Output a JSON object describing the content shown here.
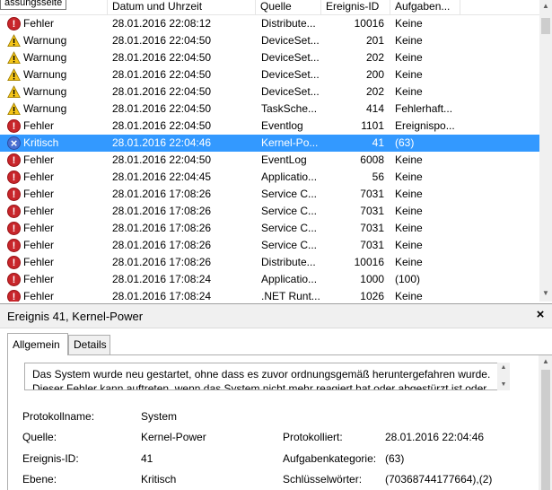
{
  "tooltip": "assungsseite",
  "list": {
    "columns": [
      "",
      "Datum und Uhrzeit",
      "Quelle",
      "Ereignis-ID",
      "Aufgaben..."
    ],
    "rows": [
      {
        "icon": "error",
        "level": "Fehler",
        "date": "28.01.2016 22:08:12",
        "source": "Distribute...",
        "id": "10016",
        "task": "Keine"
      },
      {
        "icon": "warning",
        "level": "Warnung",
        "date": "28.01.2016 22:04:50",
        "source": "DeviceSet...",
        "id": "201",
        "task": "Keine"
      },
      {
        "icon": "warning",
        "level": "Warnung",
        "date": "28.01.2016 22:04:50",
        "source": "DeviceSet...",
        "id": "202",
        "task": "Keine"
      },
      {
        "icon": "warning",
        "level": "Warnung",
        "date": "28.01.2016 22:04:50",
        "source": "DeviceSet...",
        "id": "200",
        "task": "Keine"
      },
      {
        "icon": "warning",
        "level": "Warnung",
        "date": "28.01.2016 22:04:50",
        "source": "DeviceSet...",
        "id": "202",
        "task": "Keine"
      },
      {
        "icon": "warning",
        "level": "Warnung",
        "date": "28.01.2016 22:04:50",
        "source": "TaskSche...",
        "id": "414",
        "task": "Fehlerhaft..."
      },
      {
        "icon": "error",
        "level": "Fehler",
        "date": "28.01.2016 22:04:50",
        "source": "Eventlog",
        "id": "1101",
        "task": "Ereignispo..."
      },
      {
        "icon": "critical",
        "level": "Kritisch",
        "date": "28.01.2016 22:04:46",
        "source": "Kernel-Po...",
        "id": "41",
        "task": "(63)",
        "selected": true
      },
      {
        "icon": "error",
        "level": "Fehler",
        "date": "28.01.2016 22:04:50",
        "source": "EventLog",
        "id": "6008",
        "task": "Keine"
      },
      {
        "icon": "error",
        "level": "Fehler",
        "date": "28.01.2016 22:04:45",
        "source": "Applicatio...",
        "id": "56",
        "task": "Keine"
      },
      {
        "icon": "error",
        "level": "Fehler",
        "date": "28.01.2016 17:08:26",
        "source": "Service C...",
        "id": "7031",
        "task": "Keine"
      },
      {
        "icon": "error",
        "level": "Fehler",
        "date": "28.01.2016 17:08:26",
        "source": "Service C...",
        "id": "7031",
        "task": "Keine"
      },
      {
        "icon": "error",
        "level": "Fehler",
        "date": "28.01.2016 17:08:26",
        "source": "Service C...",
        "id": "7031",
        "task": "Keine"
      },
      {
        "icon": "error",
        "level": "Fehler",
        "date": "28.01.2016 17:08:26",
        "source": "Service C...",
        "id": "7031",
        "task": "Keine"
      },
      {
        "icon": "error",
        "level": "Fehler",
        "date": "28.01.2016 17:08:26",
        "source": "Distribute...",
        "id": "10016",
        "task": "Keine"
      },
      {
        "icon": "error",
        "level": "Fehler",
        "date": "28.01.2016 17:08:24",
        "source": "Applicatio...",
        "id": "1000",
        "task": "(100)"
      },
      {
        "icon": "error",
        "level": "Fehler",
        "date": "28.01.2016 17:08:24",
        "source": ".NET Runt...",
        "id": "1026",
        "task": "Keine"
      }
    ]
  },
  "detail": {
    "title": "Ereignis 41, Kernel-Power",
    "close_glyph": "×",
    "tabs": [
      "Allgemein",
      "Details"
    ],
    "description": [
      "Das System wurde neu gestartet, ohne dass es zuvor ordnungsgemäß heruntergefahren wurde.",
      "Dieser Fehler kann auftreten, wenn das System nicht mehr reagiert hat oder abgestürzt ist oder"
    ],
    "fields": {
      "protokollname_label": "Protokollname:",
      "protokollname_value": "System",
      "quelle_label": "Quelle:",
      "quelle_value": "Kernel-Power",
      "protokolliert_label": "Protokolliert:",
      "protokolliert_value": "28.01.2016 22:04:46",
      "ereignis_id_label": "Ereignis-ID:",
      "ereignis_id_value": "41",
      "aufgabenkategorie_label": "Aufgabenkategorie:",
      "aufgabenkategorie_value": "(63)",
      "ebene_label": "Ebene:",
      "ebene_value": "Kritisch",
      "schluesselwoerter_label": "Schlüsselwörter:",
      "schluesselwoerter_value": "(70368744177664),(2)"
    }
  },
  "colors": {
    "selection": "#3399ff",
    "error_icon": "#c8262b",
    "warning_icon": "#f5c518",
    "critical_icon": "#4a6fd1"
  }
}
